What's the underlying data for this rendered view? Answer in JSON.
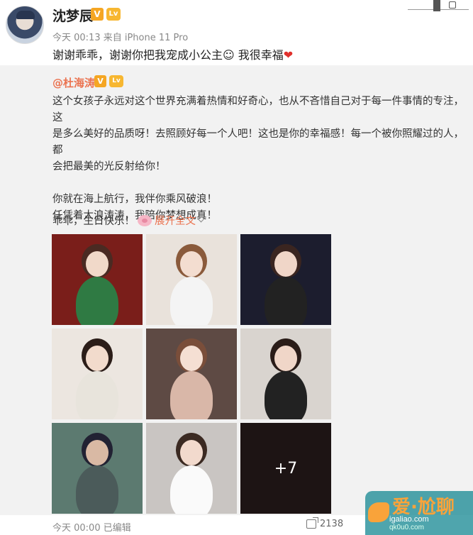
{
  "post": {
    "username": "沈梦辰",
    "vip_badge": "V",
    "member_badge": "Lv",
    "meta": "今天 00:13 来自 iPhone 11 Pro",
    "text": "谢谢乖乖，谢谢你把我宠成小公主",
    "emoji": "☺",
    "text_tail": " 我很幸福",
    "heart": "❤"
  },
  "repost": {
    "author": "@杜海涛",
    "vip_badge": "V",
    "member_badge": "Lv",
    "lines": [
      "这个女孩子永远对这个世界充满着热情和好奇心，也从不吝惜自己对于每一件事情的专注，这",
      "是多么美好的品质呀！去照顾好每一个人吧！这也是你的幸福感！每一个被你照耀过的人，都",
      "会把最美的光反射给你！"
    ],
    "lines2": [
      "你就在海上航行，我伴你乘风破浪！",
      "任凭着大浪涛涛，我陪你梦想成真！"
    ],
    "closing": "乖乖，生日快乐！",
    "expand_label": "展开全文",
    "more_count": "+7"
  },
  "photos": [
    {
      "bg": "#7a1e1a",
      "name": "photo-red-sash"
    },
    {
      "bg": "#e9e2db",
      "name": "photo-ponytail"
    },
    {
      "bg": "#1c1d2e",
      "name": "photo-stage-dance"
    },
    {
      "bg": "#ece6e0",
      "name": "photo-pigtails-costume"
    },
    {
      "bg": "#5e4a44",
      "name": "photo-closeup"
    },
    {
      "bg": "#d9d4cf",
      "name": "photo-dressing-room"
    },
    {
      "bg": "#5c7a70",
      "name": "photo-feather-headdress"
    },
    {
      "bg": "#c9c5c2",
      "name": "photo-sitting"
    },
    {
      "bg": "#1d1414",
      "name": "photo-more"
    }
  ],
  "footer": {
    "meta": "今天 00:00  已编辑",
    "share_count": "2138"
  },
  "watermark": {
    "main": "爱·尬聊",
    "sub": "igaliao.com",
    "sub2": "qk0u0.com"
  }
}
